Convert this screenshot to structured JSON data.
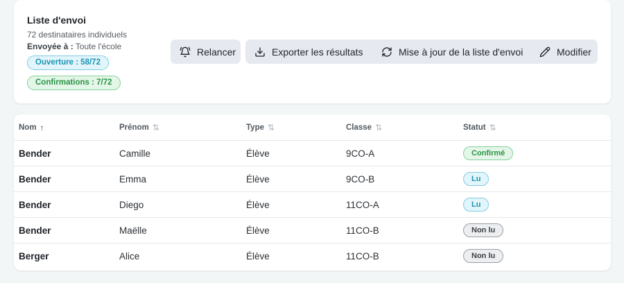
{
  "summary": {
    "title": "Liste d'envoi",
    "recipients": "72 destinataires individuels",
    "sent_to_label": "Envoyée à :",
    "sent_to_value": "Toute l'école",
    "opened_badge": "Ouverture : 58/72",
    "confirmed_badge": "Confirmations : 7/72"
  },
  "actions": {
    "remind": "Relancer",
    "export": "Exporter les résultats",
    "update": "Mise à jour de la liste d'envoi",
    "edit": "Modifier"
  },
  "table": {
    "headers": {
      "nom": "Nom",
      "prenom": "Prénom",
      "type": "Type",
      "classe": "Classe",
      "statut": "Statut"
    },
    "sort_active_icon": "↑",
    "sort_idle_icon": "⇅",
    "rows": [
      {
        "nom": "Bender",
        "prenom": "Camille",
        "type": "Élève",
        "classe": "9CO-A",
        "statut": "Confirmé",
        "status_kind": "confirm"
      },
      {
        "nom": "Bender",
        "prenom": "Emma",
        "type": "Élève",
        "classe": "9CO-B",
        "statut": "Lu",
        "status_kind": "read"
      },
      {
        "nom": "Bender",
        "prenom": "Diego",
        "type": "Élève",
        "classe": "11CO-A",
        "statut": "Lu",
        "status_kind": "read"
      },
      {
        "nom": "Bender",
        "prenom": "Maëlle",
        "type": "Élève",
        "classe": "11CO-B",
        "statut": "Non lu",
        "status_kind": "unread"
      },
      {
        "nom": "Berger",
        "prenom": "Alice",
        "type": "Élève",
        "classe": "11CO-B",
        "statut": "Non lu",
        "status_kind": "unread"
      }
    ]
  },
  "colors": {
    "background": "#f3f6f7",
    "button_bg": "#e7e9f1",
    "open_accent": "#1a94b5",
    "confirm_accent": "#2a9445"
  },
  "icons": {
    "remind": "bell-icon",
    "export": "download-icon",
    "update": "refresh-icon",
    "edit": "pencil-icon"
  }
}
